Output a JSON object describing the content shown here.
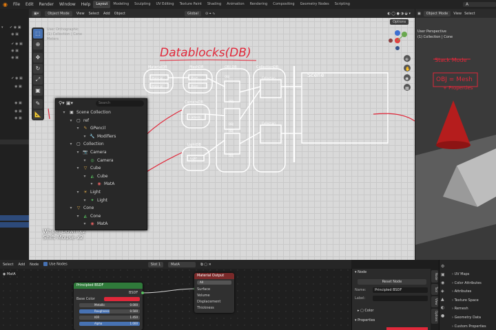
{
  "topbar": {
    "menus": [
      "File",
      "Edit",
      "Render",
      "Window",
      "Help"
    ],
    "workspaces": [
      "Layout",
      "Modeling",
      "Sculpting",
      "UV Editing",
      "Texture Paint",
      "Shading",
      "Animation",
      "Rendering",
      "Compositing",
      "Geometry Nodes",
      "Scripting"
    ],
    "active_workspace": "Layout",
    "scene_field": "A"
  },
  "viewport": {
    "mode": "Object Mode",
    "menus": [
      "View",
      "Select",
      "Add",
      "Object"
    ],
    "transform": "Global",
    "options": "Options",
    "info_lines": [
      "User Orthographic",
      "(1) Collection | Cone",
      "Meters"
    ],
    "ops_text": [
      "Wheel Down x2",
      "Shift Mouse x2"
    ],
    "title_annotation": "Datablocks(DB)",
    "db_labels": [
      "MaterialDB",
      "MeshDB",
      "OBJ DB",
      "CollectionDB",
      "CameraDB",
      "LightDB"
    ],
    "small_labels": [
      "Material",
      "Material",
      "Mesh",
      "Mesh",
      "Camera",
      "Light",
      "OBJ",
      "OBJ",
      "OBJ",
      "OBJ",
      "OBJ",
      "Collection",
      "Collection"
    ],
    "scene_label": "Scene",
    "notes": [
      "Stack Mode",
      "OBJ = Mesh",
      "+ Properties"
    ]
  },
  "outliner": {
    "search_placeholder": "Search",
    "rows": [
      {
        "label": "Scene Collection",
        "icon": "scene-collection-icon",
        "indent": 0
      },
      {
        "label": "ref",
        "icon": "collection-icon",
        "indent": 1
      },
      {
        "label": "GPencil",
        "icon": "gpencil-icon",
        "indent": 2
      },
      {
        "label": "Modifiers",
        "icon": "wrench-icon",
        "indent": 3
      },
      {
        "label": "Collection",
        "icon": "collection-icon",
        "indent": 1
      },
      {
        "label": "Camera",
        "icon": "camera-icon",
        "indent": 2
      },
      {
        "label": "Camera",
        "icon": "camera-data-icon",
        "indent": 3
      },
      {
        "label": "Cube",
        "icon": "mesh-object-icon",
        "indent": 2
      },
      {
        "label": "Cube",
        "icon": "mesh-data-icon",
        "indent": 3
      },
      {
        "label": "MatA",
        "icon": "material-icon",
        "indent": 4
      },
      {
        "label": "Light",
        "icon": "light-icon",
        "indent": 2
      },
      {
        "label": "Light",
        "icon": "light-data-icon",
        "indent": 3
      },
      {
        "label": "Cone",
        "icon": "mesh-object-icon",
        "indent": 1
      },
      {
        "label": "Cone",
        "icon": "mesh-data-icon",
        "indent": 2
      },
      {
        "label": "MatA",
        "icon": "material-icon",
        "indent": 3
      }
    ]
  },
  "right_view": {
    "mode": "Object Mode",
    "title": "User Perspective",
    "subtitle": "(1) Collection | Cone",
    "menus": [
      "View",
      "Select"
    ]
  },
  "node_editor": {
    "menus": [
      "Select",
      "Add",
      "Node"
    ],
    "use_nodes": "Use Nodes",
    "slot": "Slot 1",
    "material": "MatA",
    "object_label": "MatA",
    "bsdf_node": {
      "title": "Principled BSDF",
      "output": "BSDF",
      "rows": [
        {
          "label": "Base Color",
          "value": ""
        },
        {
          "label": "Metallic",
          "value": "0.000"
        },
        {
          "label": "Roughness",
          "value": "0.500"
        },
        {
          "label": "IOR",
          "value": "1.450"
        },
        {
          "label": "Alpha",
          "value": "1.000"
        }
      ]
    },
    "output_node": {
      "title": "Material Output",
      "target": "All",
      "inputs": [
        "Surface",
        "Volume",
        "Displacement",
        "Thickness"
      ]
    }
  },
  "npanel": {
    "section": "Node",
    "name_label": "Name:",
    "name_value": "Principled BSDF",
    "label_label": "Label:",
    "reset_button": "Reset Node",
    "color_section": "Color",
    "properties_section": "Properties",
    "tabs": [
      "Node",
      "Tool",
      "View",
      "Options"
    ]
  },
  "properties": {
    "items": [
      "UV Maps",
      "Color Attributes",
      "Attributes",
      "Texture Space",
      "Remesh",
      "Geometry Data",
      "Custom Properties"
    ]
  },
  "colors": {
    "accent": "#4772b3",
    "annotation_red": "#e0283a",
    "cone_red": "#b51d1d",
    "bsdf_header": "#2f7a3a",
    "output_header": "#7a2a2a"
  }
}
